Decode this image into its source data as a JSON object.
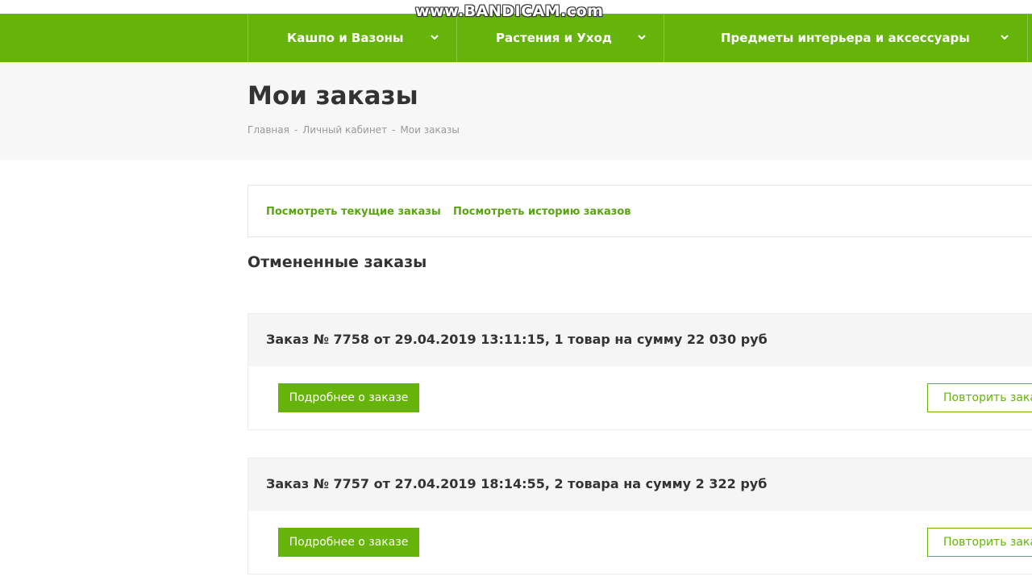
{
  "watermark": "www.BANDICAM.com",
  "nav": {
    "items": [
      {
        "label": "Кашпо и Вазоны"
      },
      {
        "label": "Растения и Уход"
      },
      {
        "label": "Предметы интерьера и аксессуары"
      }
    ]
  },
  "header": {
    "title": "Мои заказы",
    "breadcrumb": [
      "Главная",
      "Личный кабинет",
      "Мои заказы"
    ]
  },
  "links": {
    "current": "Посмотреть текущие заказы",
    "history": "Посмотреть историю заказов"
  },
  "section_title": "Отмененные заказы",
  "orders": [
    {
      "title": "Заказ № 7758 от 29.04.2019 13:11:15, 1 товар на сумму 22 030 руб",
      "detail_label": "Подробнее о заказе",
      "repeat_label": "Повторить заказ"
    },
    {
      "title": "Заказ № 7757 от 27.04.2019 18:14:55, 2 товара на сумму 2 322 руб",
      "detail_label": "Подробнее о заказе",
      "repeat_label": "Повторить заказ"
    }
  ],
  "colors": {
    "brand_green": "#66b30a",
    "link_green": "#5aa414",
    "header_band": "#f7f7f7",
    "order_head": "#f5f5f5"
  }
}
